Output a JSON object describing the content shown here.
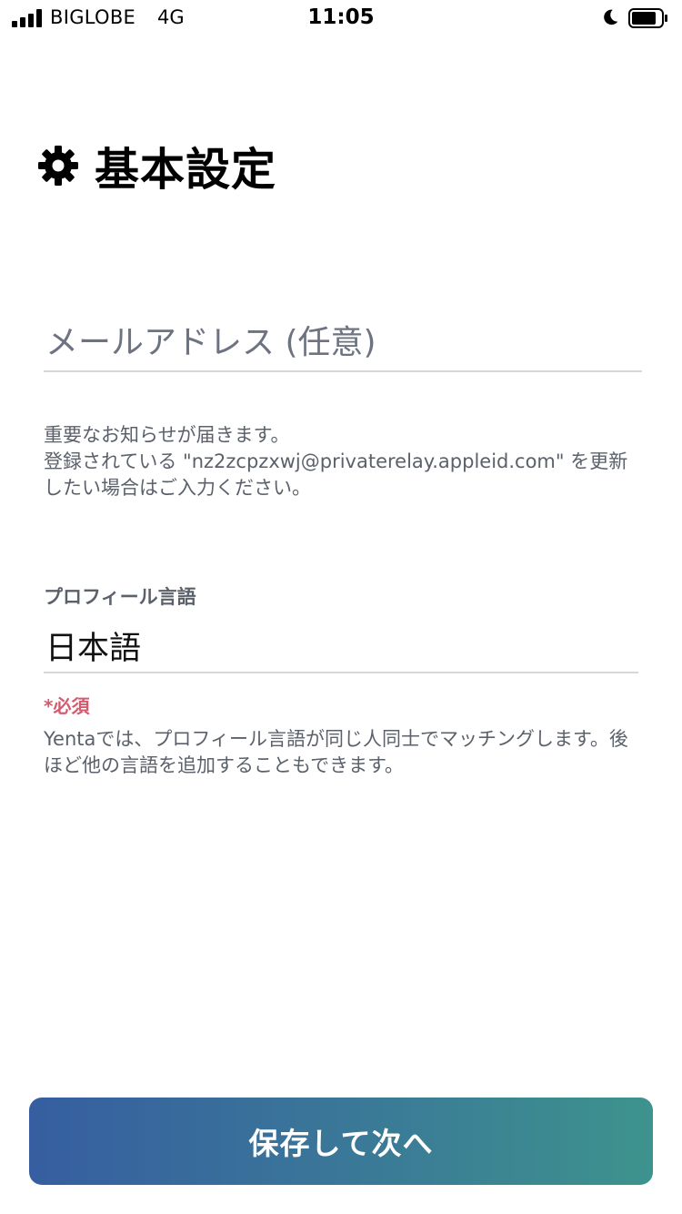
{
  "status_bar": {
    "carrier": "BIGLOBE",
    "network": "4G",
    "time": "11:05"
  },
  "header": {
    "title": "基本設定",
    "icon": "gear-icon"
  },
  "email": {
    "placeholder": "メールアドレス (任意)",
    "value": "",
    "help_line1": "重要なお知らせが届きます。",
    "help_line2": "登録されている \"nz2zcpzxwj@privaterelay.appleid.com\" を更新したい場合はご入力ください。"
  },
  "language": {
    "label": "プロフィール言語",
    "selected": "日本語",
    "required": "*必須",
    "help": "Yentaでは、プロフィール言語が同じ人同士でマッチングします。後ほど他の言語を追加することもできます。"
  },
  "footer": {
    "save_label": "保存して次へ"
  },
  "colors": {
    "required": "#d65a6e",
    "button_gradient_start": "#365ea0",
    "button_gradient_end": "#3d938d",
    "help_text": "#5b616b"
  }
}
